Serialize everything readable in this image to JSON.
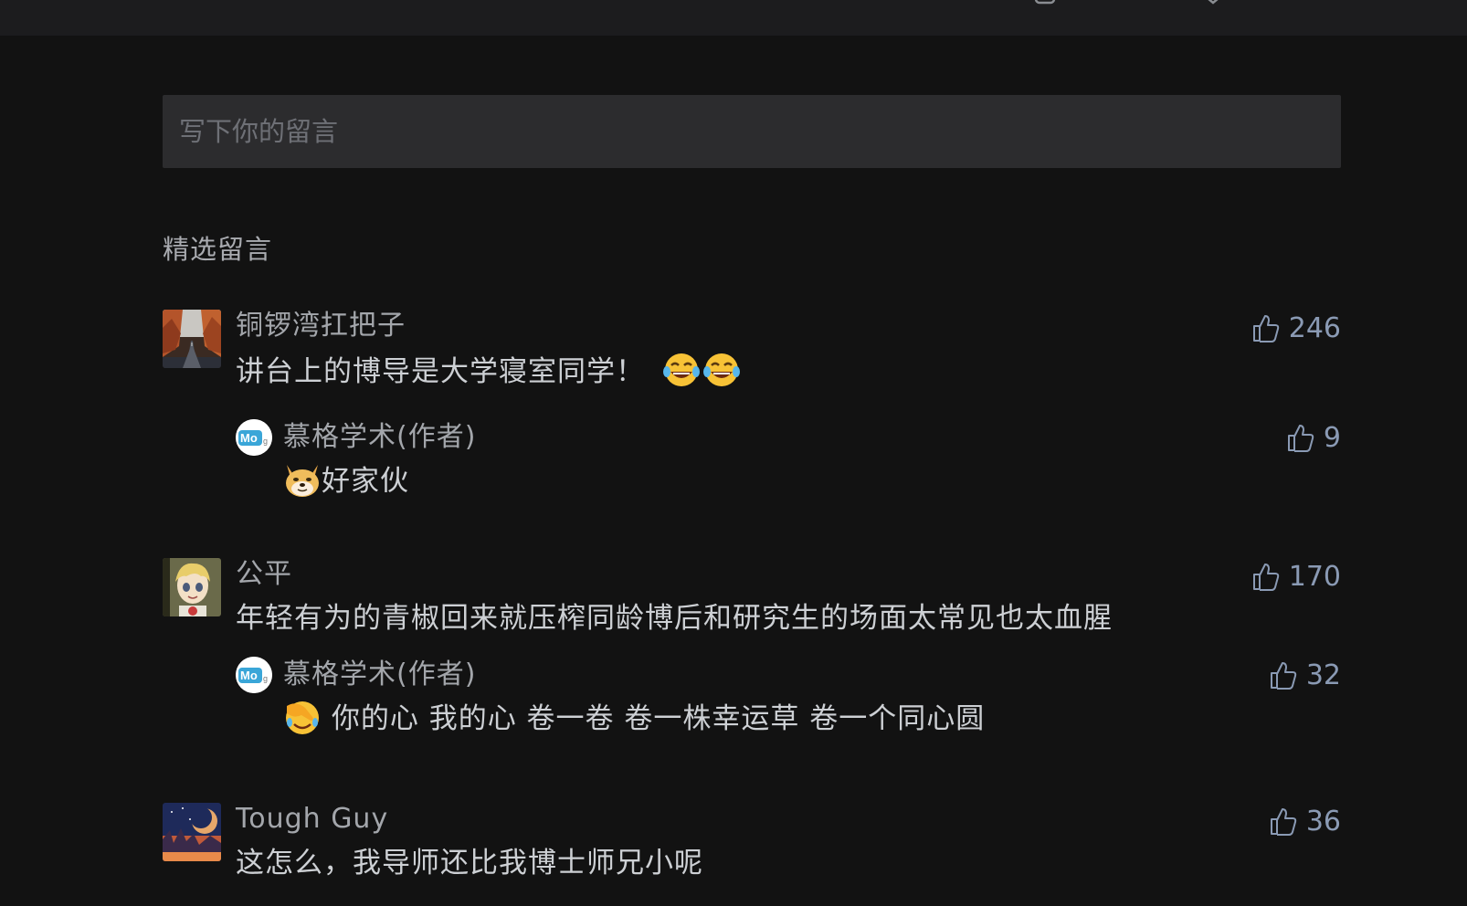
{
  "input": {
    "placeholder": "写下你的留言"
  },
  "section_title": "精选留言",
  "comments": [
    {
      "username": "铜锣湾扛把子",
      "text": "讲台上的博导是大学寝室同学！",
      "emoji": [
        "laughing-tears-emoji",
        "laughing-tears-emoji"
      ],
      "likes": "246",
      "reply": {
        "username": "慕格学术(作者)",
        "text": "好家伙",
        "emoji": "doge-emoji",
        "likes": "9"
      }
    },
    {
      "username": "公平",
      "text": "年轻有为的青椒回来就压榨同龄博后和研究生的场面太常见也太血腥",
      "likes": "170",
      "reply": {
        "username": "慕格学术(作者)",
        "text": " 你的心 我的心 卷一卷 卷一株幸运草 卷一个同心圆",
        "emoji": "facepalm-emoji",
        "likes": "32"
      }
    },
    {
      "username": "Tough Guy",
      "text": "这怎么，我导师还比我博士师兄小呢",
      "likes": "36"
    }
  ],
  "colors": {
    "background": "#121212",
    "input_bg": "#2c2c2e",
    "like_color": "#8a9ab4",
    "text": "#cdd0d4",
    "username": "#a3a6ab"
  }
}
